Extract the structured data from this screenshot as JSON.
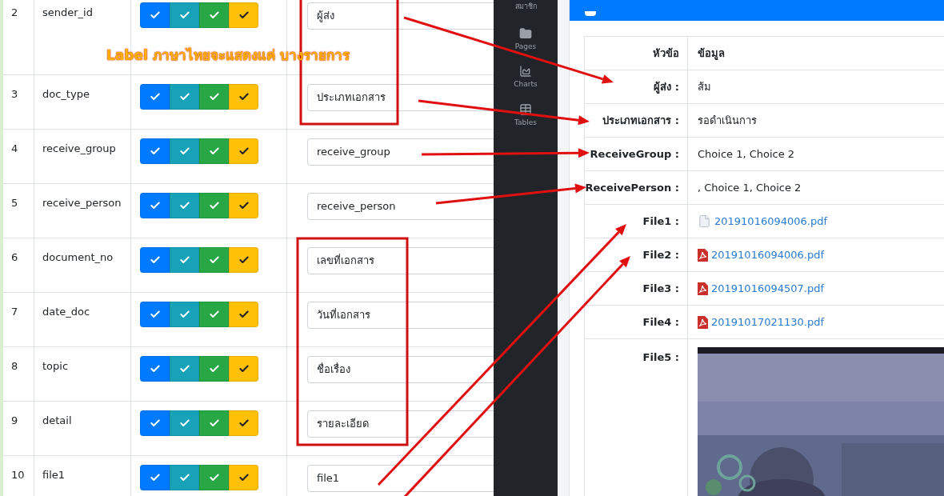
{
  "form_rows": [
    {
      "number": "2",
      "field": "sender_id",
      "value": "ผู้ส่ง"
    },
    {
      "number": "3",
      "field": "doc_type",
      "value": "ประเภทเอกสาร"
    },
    {
      "number": "4",
      "field": "receive_group",
      "value": "receive_group"
    },
    {
      "number": "5",
      "field": "receive_person",
      "value": "receive_person"
    },
    {
      "number": "6",
      "field": "document_no",
      "value": "เลขที่เอกสาร"
    },
    {
      "number": "7",
      "field": "date_doc",
      "value": "วันที่เอกสาร"
    },
    {
      "number": "8",
      "field": "topic",
      "value": "ชื่อเรื่อง"
    },
    {
      "number": "9",
      "field": "detail",
      "value": "รายละเอียด"
    },
    {
      "number": "10",
      "field": "file1",
      "value": "file1"
    }
  ],
  "annotation": {
    "note": "Label ภาษาไทยจะแสดงแค่ บางรายการ"
  },
  "sidebar": {
    "items": [
      {
        "label": "สมาชิก"
      },
      {
        "label": "Pages"
      },
      {
        "label": "Charts"
      },
      {
        "label": "Tables"
      }
    ]
  },
  "detail_table": {
    "columns": [
      "หัวข้อ",
      "ข้อมูล"
    ],
    "rows": [
      {
        "kind": "text",
        "label": "ผู้ส่ง :",
        "value": "ส้ม"
      },
      {
        "kind": "text",
        "label": "ประเภทเอกสาร :",
        "value": "รอดำเนินการ"
      },
      {
        "kind": "text",
        "label": "ReceiveGroup :",
        "value": "Choice 1, Choice 2"
      },
      {
        "kind": "text",
        "label": "ReceivePerson :",
        "value": ", Choice 1, Choice 2"
      },
      {
        "kind": "file",
        "label": "File1 :",
        "value": "20191016094006.pdf"
      },
      {
        "kind": "pdf",
        "label": "File2 :",
        "value": "20191016094006.pdf"
      },
      {
        "kind": "pdf",
        "label": "File3 :",
        "value": "20191016094507.pdf"
      },
      {
        "kind": "pdf",
        "label": "File4 :",
        "value": "20191017021130.pdf"
      },
      {
        "kind": "picture",
        "label": "File5 :"
      }
    ]
  }
}
